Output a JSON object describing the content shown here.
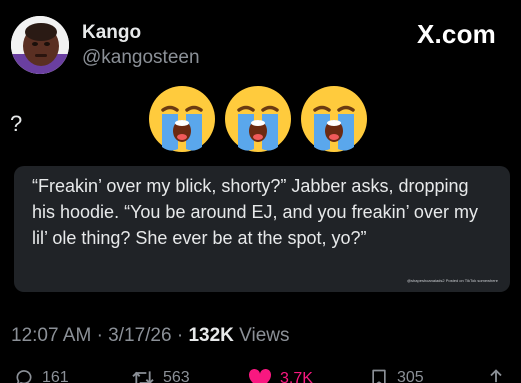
{
  "author": {
    "display_name": "Kango",
    "handle": "@kangosteen",
    "avatar_icon": "avatar-photo"
  },
  "brand": "X.com",
  "tweet": {
    "text": "?",
    "emoji": [
      "loudly-crying-face",
      "loudly-crying-face",
      "loudly-crying-face"
    ]
  },
  "quote": {
    "text": "“Freakin’ over my blick, shorty?” Jabber asks, dropping his hoodie. “You be around EJ, and you freakin’ over my lil’ ole thing? She ever be at the spot, yo?”",
    "watermark": "@shapeshoanaiads2 Posted on TikTok somewhere"
  },
  "meta": {
    "time": "12:07 AM",
    "separator": "·",
    "date": "3/17/26",
    "views_count": "132K",
    "views_label": "Views"
  },
  "actions": {
    "replies": "161",
    "reposts": "563",
    "likes": "3.7K",
    "bookmarks": "305"
  },
  "colors": {
    "background": "#000000",
    "card": "#202327",
    "text": "#e7e9ea",
    "muted": "#8b9097",
    "like": "#f91880"
  }
}
